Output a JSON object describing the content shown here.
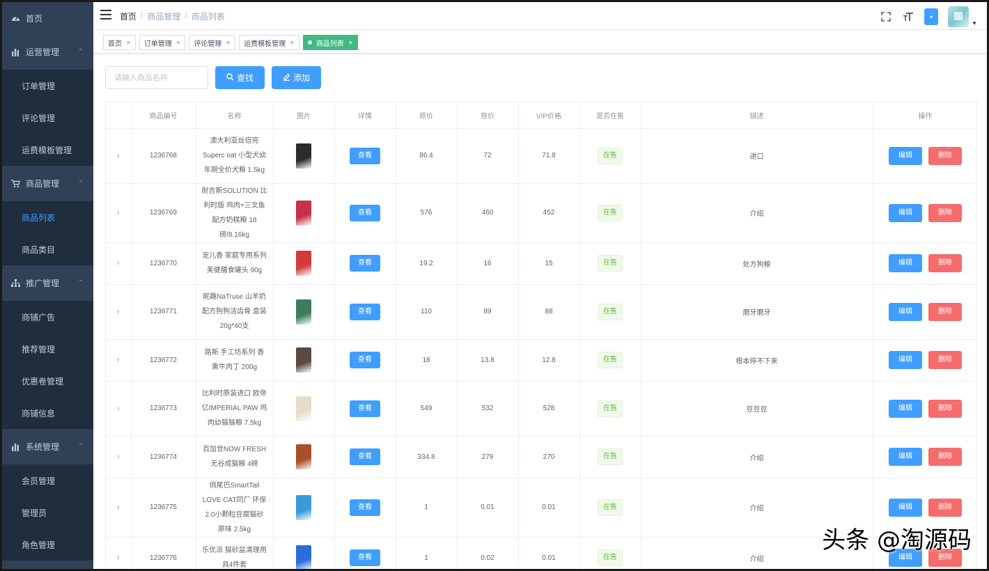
{
  "sidebar": {
    "home": "首页",
    "groups": [
      {
        "label": "运营管理",
        "icon": "bar-chart-icon",
        "items": [
          "订单管理",
          "评论管理",
          "运费模板管理"
        ]
      },
      {
        "label": "商品管理",
        "icon": "cart-icon",
        "items": [
          "商品列表",
          "商品类目"
        ],
        "active_item": "商品列表"
      },
      {
        "label": "推广管理",
        "icon": "sitemap-icon",
        "items": [
          "商铺广告",
          "推荐管理",
          "优惠卷管理",
          "商铺信息"
        ]
      },
      {
        "label": "系统管理",
        "icon": "bar-chart-icon",
        "items": [
          "会员管理",
          "管理员",
          "角色管理"
        ]
      }
    ]
  },
  "breadcrumb": [
    "首页",
    "商品管理",
    "商品列表"
  ],
  "tags": [
    {
      "label": "首页",
      "active": false
    },
    {
      "label": "订单管理",
      "active": false
    },
    {
      "label": "评论管理",
      "active": false
    },
    {
      "label": "运费模板管理",
      "active": false
    },
    {
      "label": "商品列表",
      "active": true
    }
  ],
  "filters": {
    "search_placeholder": "请输入商品名称",
    "search_label": "查找",
    "add_label": "添加"
  },
  "table": {
    "headers": [
      "",
      "商品编号",
      "名称",
      "图片",
      "详情",
      "原价",
      "现价",
      "VIP价格",
      "是否在售",
      "描述",
      "操作"
    ],
    "view_label": "查看",
    "edit_label": "编辑",
    "delete_label": "删除",
    "rows": [
      {
        "id": "1236768",
        "name": "澳大利亚丝倍亮Superc oat 小型犬幼年期全价犬粮 1.5kg",
        "original": "86.4",
        "current": "72",
        "vip": "71.8",
        "status": "在售",
        "desc": "进口",
        "img_color": "#2b2b2b"
      },
      {
        "id": "1236769",
        "name": "耐吉斯SOLUTION 比利时版 鸡肉+三文鱼配方奶糕粮 18磅/8.16kg",
        "original": "576",
        "current": "460",
        "vip": "452",
        "status": "在售",
        "desc": "介绍",
        "img_color": "#c9314a"
      },
      {
        "id": "1236770",
        "name": "宠儿香 家庭专用系列 美健膳食罐头 90g",
        "original": "19.2",
        "current": "16",
        "vip": "15",
        "status": "在售",
        "desc": "处方狗粮",
        "img_color": "#d43a3a"
      },
      {
        "id": "1236771",
        "name": "昵趣NaTruse 山羊奶配方狗狗洁齿骨 盒装20g*40支",
        "original": "110",
        "current": "89",
        "vip": "88",
        "status": "在售",
        "desc": "磨牙磨牙",
        "img_color": "#3d7d5a"
      },
      {
        "id": "1236772",
        "name": "路斯 手工坊系列 香熏牛肉丁 200g",
        "original": "18",
        "current": "13.8",
        "vip": "12.8",
        "status": "在售",
        "desc": "根本停不下来",
        "img_color": "#5a4a40"
      },
      {
        "id": "1236773",
        "name": "比利时原装进口 欧帝亿IMPERIAL PAW 鸡肉幼猫猫粮 7.5kg",
        "original": "549",
        "current": "532",
        "vip": "528",
        "status": "在售",
        "desc": "豆豆豆",
        "img_color": "#e8dcc8"
      },
      {
        "id": "1236774",
        "name": "百加世NOW FRESH 无谷成猫粮 4磅",
        "original": "334.8",
        "current": "279",
        "vip": "270",
        "status": "在售",
        "desc": "介绍",
        "img_color": "#a8502a"
      },
      {
        "id": "1236775",
        "name": "俏尾巴SmartTail LOVE CAT同厂 环保2.0小颗粒豆腐猫砂 原味 2.5kg",
        "original": "1",
        "current": "0.01",
        "vip": "0.01",
        "status": "在售",
        "desc": "介绍",
        "img_color": "#3a9ad9"
      },
      {
        "id": "1236776",
        "name": "乐优派 猫砂盆清理用具4件套",
        "original": "1",
        "current": "0.02",
        "vip": "0.01",
        "status": "在售",
        "desc": "介绍",
        "img_color": "#2a6fd6"
      }
    ]
  },
  "watermark": "头条 @淘源码"
}
